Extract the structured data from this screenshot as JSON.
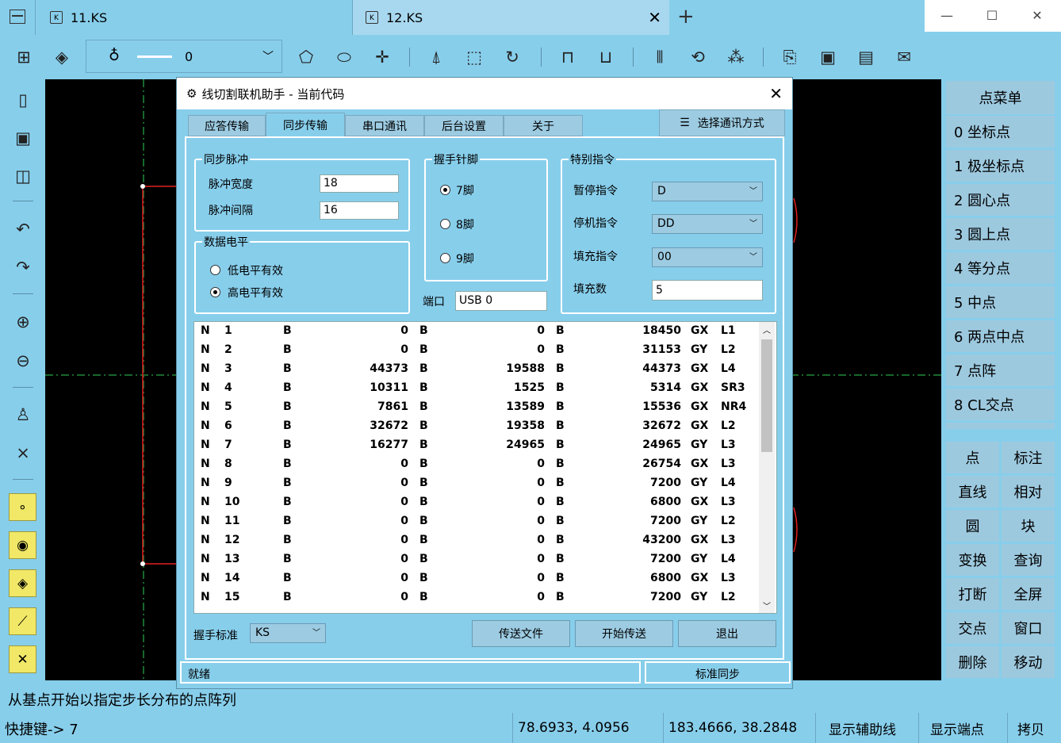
{
  "tabs": [
    {
      "label": "11.KS"
    },
    {
      "label": "12.KS"
    }
  ],
  "toolbar": {
    "layer_value": "0"
  },
  "right_panel": {
    "title": "点菜单",
    "items": [
      "0  坐标点",
      "1  极坐标点",
      "2  圆心点",
      "3  圆上点",
      "4  等分点",
      "5  中点",
      "6  两点中点",
      "7  点阵",
      "8  CL交点"
    ],
    "grid": [
      "点",
      "标注",
      "直线",
      "相对",
      "圆",
      "块",
      "变换",
      "查询",
      "打断",
      "全屏",
      "交点",
      "窗口",
      "删除",
      "移动"
    ]
  },
  "status": {
    "prompt": "从基点开始以指定步长分布的点阵列",
    "shortcut": "快捷键-> 7",
    "coord1": "78.6933, 4.0956",
    "coord2": "183.4666, 38.2848",
    "btn_aux": "显示辅助线",
    "btn_end": "显示端点",
    "btn_copy": "拷贝"
  },
  "dialog": {
    "title": "线切割联机助手 - 当前代码",
    "tabs": [
      "应答传输",
      "同步传输",
      "串口通讯",
      "后台设置",
      "关于"
    ],
    "comm_button": "选择通讯方式",
    "sync_pulse": {
      "title": "同步脉冲",
      "width_label": "脉冲宽度",
      "width_value": "18",
      "gap_label": "脉冲间隔",
      "gap_value": "16"
    },
    "data_level": {
      "title": "数据电平",
      "low": "低电平有效",
      "high": "高电平有效"
    },
    "pins": {
      "title": "握手针脚",
      "p7": "7脚",
      "p8": "8脚",
      "p9": "9脚"
    },
    "port": {
      "label": "端口",
      "value": "USB 0"
    },
    "special": {
      "title": "特别指令",
      "pause_label": "暂停指令",
      "pause_value": "D",
      "stop_label": "停机指令",
      "stop_value": "DD",
      "fill_label": "填充指令",
      "fill_value": "00",
      "fillnum_label": "填充数",
      "fillnum_value": "5"
    },
    "code_rows": [
      [
        "N",
        "1",
        "B",
        "0",
        "B",
        "0",
        "B",
        "18450",
        "GX",
        "L1"
      ],
      [
        "N",
        "2",
        "B",
        "0",
        "B",
        "0",
        "B",
        "31153",
        "GY",
        "L2"
      ],
      [
        "N",
        "3",
        "B",
        "44373",
        "B",
        "19588",
        "B",
        "44373",
        "GX",
        "L4"
      ],
      [
        "N",
        "4",
        "B",
        "10311",
        "B",
        "1525",
        "B",
        "5314",
        "GX",
        "SR3"
      ],
      [
        "N",
        "5",
        "B",
        "7861",
        "B",
        "13589",
        "B",
        "15536",
        "GX",
        "NR4"
      ],
      [
        "N",
        "6",
        "B",
        "32672",
        "B",
        "19358",
        "B",
        "32672",
        "GX",
        "L2"
      ],
      [
        "N",
        "7",
        "B",
        "16277",
        "B",
        "24965",
        "B",
        "24965",
        "GY",
        "L3"
      ],
      [
        "N",
        "8",
        "B",
        "0",
        "B",
        "0",
        "B",
        "26754",
        "GX",
        "L3"
      ],
      [
        "N",
        "9",
        "B",
        "0",
        "B",
        "0",
        "B",
        "7200",
        "GY",
        "L4"
      ],
      [
        "N",
        "10",
        "B",
        "0",
        "B",
        "0",
        "B",
        "6800",
        "GX",
        "L3"
      ],
      [
        "N",
        "11",
        "B",
        "0",
        "B",
        "0",
        "B",
        "7200",
        "GY",
        "L2"
      ],
      [
        "N",
        "12",
        "B",
        "0",
        "B",
        "0",
        "B",
        "43200",
        "GX",
        "L3"
      ],
      [
        "N",
        "13",
        "B",
        "0",
        "B",
        "0",
        "B",
        "7200",
        "GY",
        "L4"
      ],
      [
        "N",
        "14",
        "B",
        "0",
        "B",
        "0",
        "B",
        "6800",
        "GX",
        "L3"
      ],
      [
        "N",
        "15",
        "B",
        "0",
        "B",
        "0",
        "B",
        "7200",
        "GY",
        "L2"
      ]
    ],
    "handshake_label": "握手标准",
    "handshake_value": "KS",
    "btn_send_file": "传送文件",
    "btn_start": "开始传送",
    "btn_exit": "退出",
    "status_text": "就绪",
    "status_mode": "标准同步"
  }
}
